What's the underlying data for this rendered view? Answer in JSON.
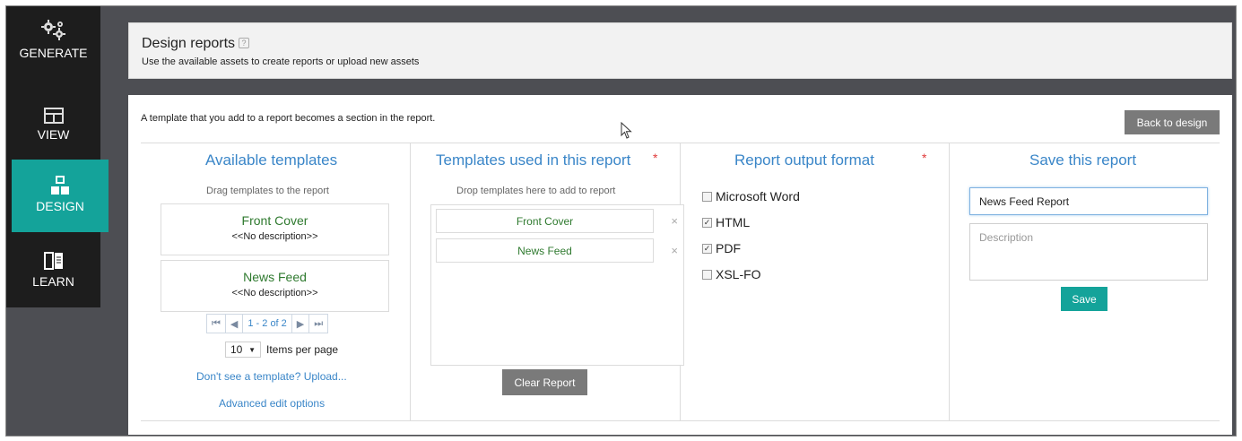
{
  "sidebar": {
    "items": [
      {
        "label": "GENERATE",
        "icon": "gears-icon"
      },
      {
        "label": "VIEW",
        "icon": "table-icon"
      },
      {
        "label": "DESIGN",
        "icon": "blocks-icon"
      },
      {
        "label": "LEARN",
        "icon": "book-icon"
      }
    ],
    "active": "DESIGN"
  },
  "header": {
    "title": "Design reports",
    "help_icon": "?",
    "subtitle": "Use the available assets to create reports or upload new assets"
  },
  "main": {
    "intro": "A template that you add to a report becomes a section in the report.",
    "back_label": "Back to design",
    "available": {
      "title": "Available templates",
      "hint": "Drag templates to the report",
      "templates": [
        {
          "name": "Front Cover",
          "description": "<<No description>>"
        },
        {
          "name": "News Feed",
          "description": "<<No description>>"
        }
      ],
      "pager": {
        "info": "1 - 2 of 2"
      },
      "per_page_value": "10",
      "per_page_label": "Items per page",
      "upload_link": "Don't see a template? Upload...",
      "advanced_link": "Advanced edit options"
    },
    "used": {
      "title": "Templates used in this report",
      "required": "*",
      "hint": "Drop templates here to add to report",
      "items": [
        "Front Cover",
        "News Feed"
      ],
      "remove_glyph": "×",
      "clear_label": "Clear Report"
    },
    "output": {
      "title": "Report output format",
      "required": "*",
      "formats": [
        {
          "label": "Microsoft Word",
          "checked": false
        },
        {
          "label": "HTML",
          "checked": true
        },
        {
          "label": "PDF",
          "checked": true
        },
        {
          "label": "XSL-FO",
          "checked": false
        }
      ]
    },
    "save": {
      "title": "Save this report",
      "name_value": "News Feed Report",
      "description_placeholder": "Description",
      "save_label": "Save"
    }
  },
  "colors": {
    "accent": "#14a39a",
    "link": "#3a86c8",
    "template_name": "#2f7a2f",
    "required": "#e03a3a"
  }
}
